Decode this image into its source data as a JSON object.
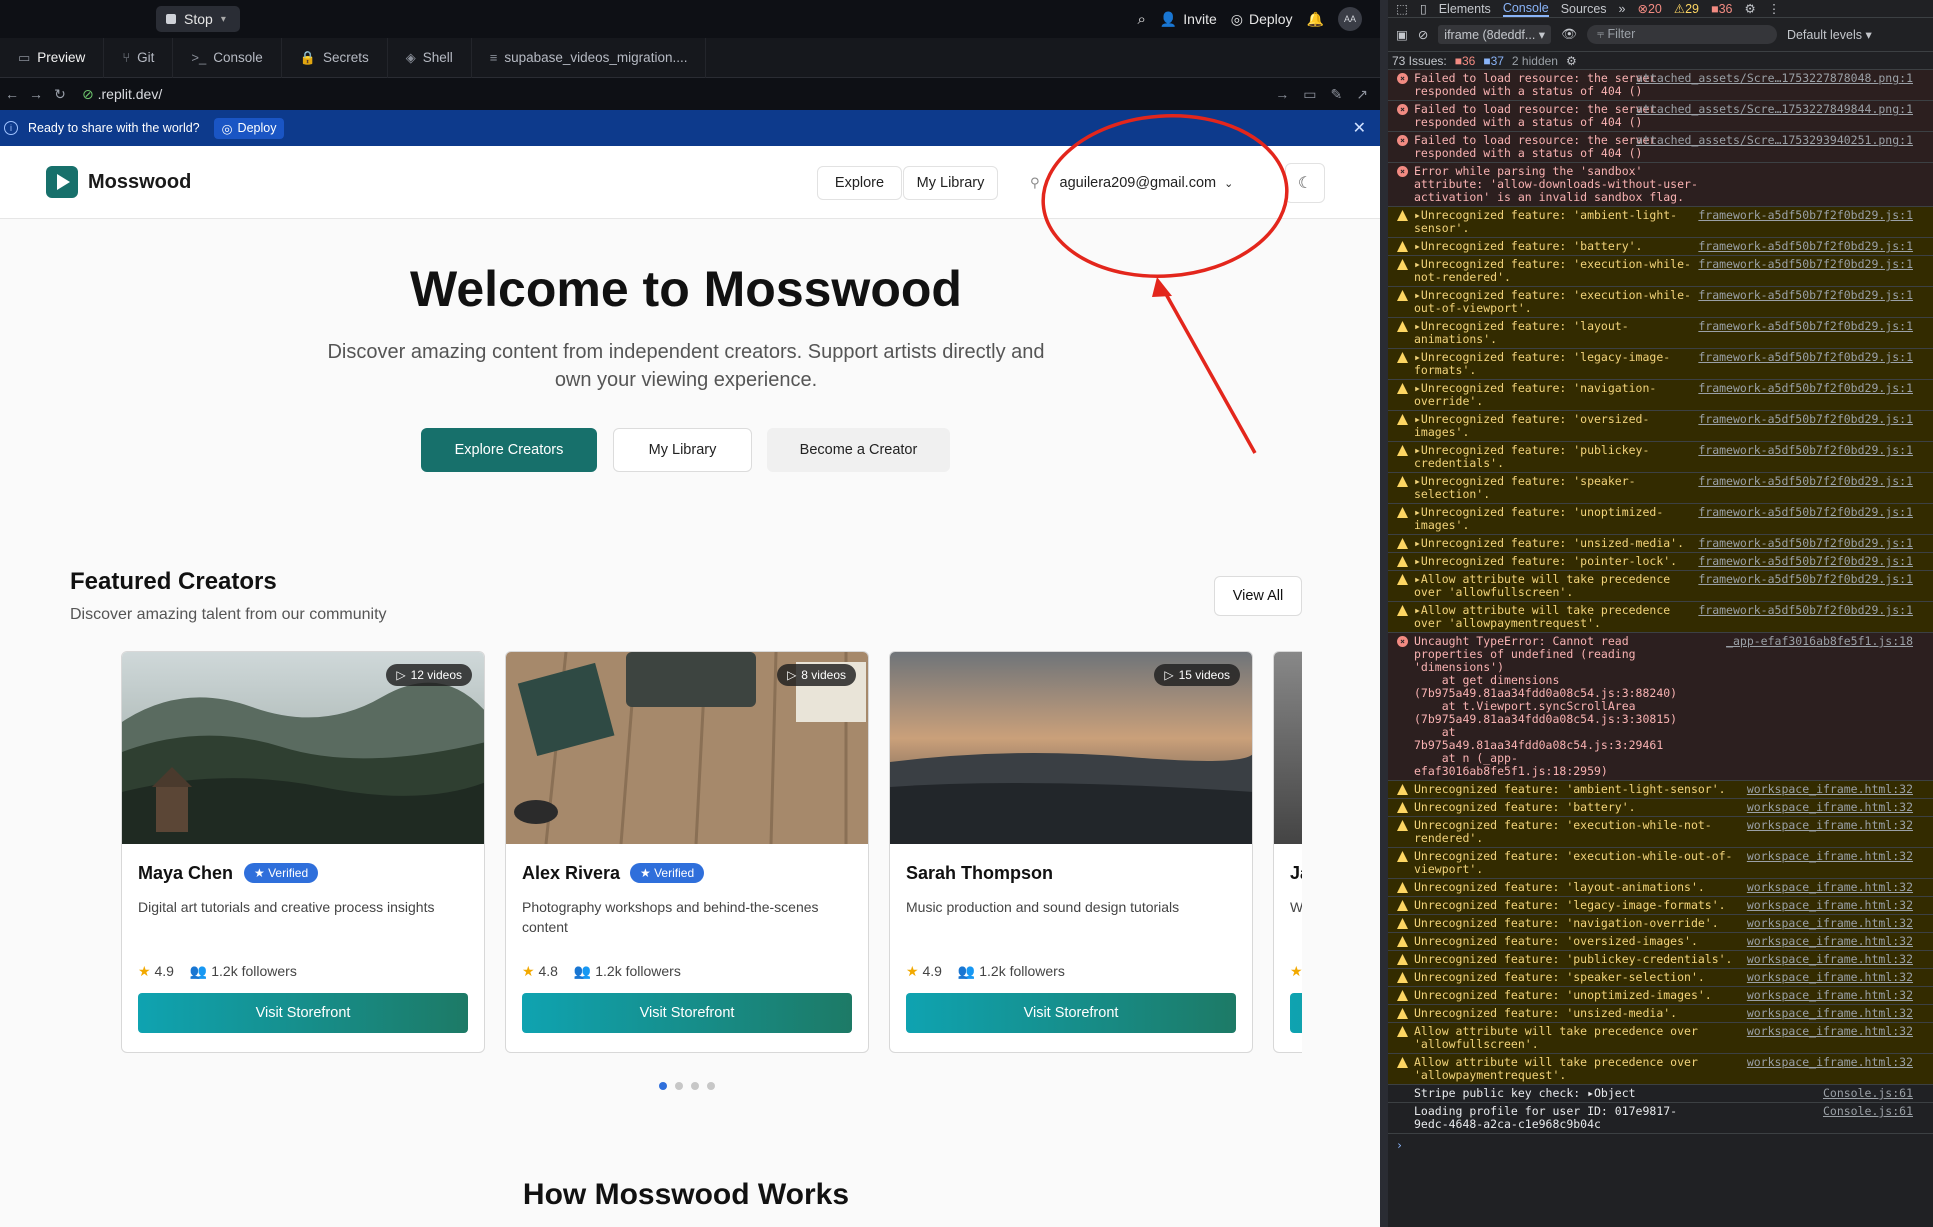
{
  "replit": {
    "stop_label": "Stop",
    "invite_label": "Invite",
    "deploy_label": "Deploy",
    "avatar_initials": "AA",
    "tabs": [
      {
        "label": "Preview",
        "icon": "monitor-icon"
      },
      {
        "label": "Git",
        "icon": "git-icon"
      },
      {
        "label": "Console",
        "icon": "terminal-icon"
      },
      {
        "label": "Secrets",
        "icon": "lock-icon"
      },
      {
        "label": "Shell",
        "icon": "shell-icon"
      },
      {
        "label": "supabase_videos_migration....",
        "icon": "file-icon"
      }
    ],
    "url": ".replit.dev/",
    "banner_text": "Ready to share with the world?",
    "banner_deploy": "Deploy"
  },
  "site": {
    "brand": "Mosswood",
    "nav": {
      "explore": "Explore",
      "library": "My Library"
    },
    "user_email": "aguilera209@gmail.com",
    "hero": {
      "title": "Welcome to Mosswood",
      "subtitle": "Discover amazing content from independent creators. Support artists directly and own your viewing experience.",
      "primary": "Explore Creators",
      "secondary": "My Library",
      "tertiary": "Become a Creator"
    },
    "featured": {
      "title": "Featured Creators",
      "subtitle": "Discover amazing talent from our community",
      "view_all": "View All"
    },
    "cards": [
      {
        "badge": "12 videos",
        "name": "Maya Chen",
        "verified": "Verified",
        "desc": "Digital art tutorials and creative process insights",
        "rating": "4.9",
        "followers": "1.2k followers",
        "cta": "Visit Storefront"
      },
      {
        "badge": "8 videos",
        "name": "Alex Rivera",
        "verified": "Verified",
        "desc": "Photography workshops and behind-the-scenes content",
        "rating": "4.8",
        "followers": "1.2k followers",
        "cta": "Visit Storefront"
      },
      {
        "badge": "15 videos",
        "name": "Sarah Thompson",
        "verified": "",
        "desc": "Music production and sound design tutorials",
        "rating": "4.9",
        "followers": "1.2k followers",
        "cta": "Visit Storefront"
      },
      {
        "badge": "",
        "name": "Ja",
        "verified": "",
        "desc": "W",
        "rating": "",
        "followers": "",
        "cta": ""
      }
    ],
    "how_title": "How Mosswood Works"
  },
  "devtools": {
    "tabs": [
      "Elements",
      "Console",
      "Sources"
    ],
    "err_count": "20",
    "warn_count": "29",
    "issue_count": "36",
    "context": "iframe (8deddf...",
    "filter": "Filter",
    "levels": "Default levels",
    "issues_label": "73 Issues:",
    "issues_err": "36",
    "issues_info": "37",
    "hidden": "2 hidden",
    "logs": [
      {
        "level": "err",
        "msg": "Failed to load resource: the server responded with a status of 404 ()",
        "src": "attached_assets/Scre…1753227878048.png:1"
      },
      {
        "level": "err",
        "msg": "Failed to load resource: the server responded with a status of 404 ()",
        "src": "attached_assets/Scre…1753227849844.png:1"
      },
      {
        "level": "err",
        "msg": "Failed to load resource: the server responded with a status of 404 ()",
        "src": "attached_assets/Scre…1753293940251.png:1"
      },
      {
        "level": "err",
        "msg": "Error while parsing the 'sandbox' attribute: 'allow-downloads-without-user-activation' is an invalid sandbox flag.",
        "src": ""
      },
      {
        "level": "warn",
        "msg": "▸Unrecognized feature: 'ambient-light-sensor'.",
        "src": "framework-a5df50b7f2f0bd29.js:1"
      },
      {
        "level": "warn",
        "msg": "▸Unrecognized feature: 'battery'.",
        "src": "framework-a5df50b7f2f0bd29.js:1"
      },
      {
        "level": "warn",
        "msg": "▸Unrecognized feature: 'execution-while-not-rendered'.",
        "src": "framework-a5df50b7f2f0bd29.js:1"
      },
      {
        "level": "warn",
        "msg": "▸Unrecognized feature: 'execution-while-out-of-viewport'.",
        "src": "framework-a5df50b7f2f0bd29.js:1"
      },
      {
        "level": "warn",
        "msg": "▸Unrecognized feature: 'layout-animations'.",
        "src": "framework-a5df50b7f2f0bd29.js:1"
      },
      {
        "level": "warn",
        "msg": "▸Unrecognized feature: 'legacy-image-formats'.",
        "src": "framework-a5df50b7f2f0bd29.js:1"
      },
      {
        "level": "warn",
        "msg": "▸Unrecognized feature: 'navigation-override'.",
        "src": "framework-a5df50b7f2f0bd29.js:1"
      },
      {
        "level": "warn",
        "msg": "▸Unrecognized feature: 'oversized-images'.",
        "src": "framework-a5df50b7f2f0bd29.js:1"
      },
      {
        "level": "warn",
        "msg": "▸Unrecognized feature: 'publickey-credentials'.",
        "src": "framework-a5df50b7f2f0bd29.js:1"
      },
      {
        "level": "warn",
        "msg": "▸Unrecognized feature: 'speaker-selection'.",
        "src": "framework-a5df50b7f2f0bd29.js:1"
      },
      {
        "level": "warn",
        "msg": "▸Unrecognized feature: 'unoptimized-images'.",
        "src": "framework-a5df50b7f2f0bd29.js:1"
      },
      {
        "level": "warn",
        "msg": "▸Unrecognized feature: 'unsized-media'.",
        "src": "framework-a5df50b7f2f0bd29.js:1"
      },
      {
        "level": "warn",
        "msg": "▸Unrecognized feature: 'pointer-lock'.",
        "src": "framework-a5df50b7f2f0bd29.js:1"
      },
      {
        "level": "warn",
        "msg": "▸Allow attribute will take precedence over 'allowfullscreen'.",
        "src": "framework-a5df50b7f2f0bd29.js:1"
      },
      {
        "level": "warn",
        "msg": "▸Allow attribute will take precedence over 'allowpaymentrequest'.",
        "src": "framework-a5df50b7f2f0bd29.js:1"
      },
      {
        "level": "err",
        "msg": "Uncaught TypeError: Cannot read properties of undefined (reading 'dimensions')\n    at get dimensions (7b975a49.81aa34fdd0a08c54.js:3:88240)\n    at t.Viewport.syncScrollArea (7b975a49.81aa34fdd0a08c54.js:3:30815)\n    at 7b975a49.81aa34fdd0a08c54.js:3:29461\n    at n (_app-efaf3016ab8fe5f1.js:18:2959)",
        "src": "_app-efaf3016ab8fe5f1.js:18"
      },
      {
        "level": "warn",
        "msg": "Unrecognized feature: 'ambient-light-sensor'.",
        "src": "workspace_iframe.html:32"
      },
      {
        "level": "warn",
        "msg": "Unrecognized feature: 'battery'.",
        "src": "workspace_iframe.html:32"
      },
      {
        "level": "warn",
        "msg": "Unrecognized feature: 'execution-while-not-rendered'.",
        "src": "workspace_iframe.html:32"
      },
      {
        "level": "warn",
        "msg": "Unrecognized feature: 'execution-while-out-of-viewport'.",
        "src": "workspace_iframe.html:32"
      },
      {
        "level": "warn",
        "msg": "Unrecognized feature: 'layout-animations'.",
        "src": "workspace_iframe.html:32"
      },
      {
        "level": "warn",
        "msg": "Unrecognized feature: 'legacy-image-formats'.",
        "src": "workspace_iframe.html:32"
      },
      {
        "level": "warn",
        "msg": "Unrecognized feature: 'navigation-override'.",
        "src": "workspace_iframe.html:32"
      },
      {
        "level": "warn",
        "msg": "Unrecognized feature: 'oversized-images'.",
        "src": "workspace_iframe.html:32"
      },
      {
        "level": "warn",
        "msg": "Unrecognized feature: 'publickey-credentials'.",
        "src": "workspace_iframe.html:32"
      },
      {
        "level": "warn",
        "msg": "Unrecognized feature: 'speaker-selection'.",
        "src": "workspace_iframe.html:32"
      },
      {
        "level": "warn",
        "msg": "Unrecognized feature: 'unoptimized-images'.",
        "src": "workspace_iframe.html:32"
      },
      {
        "level": "warn",
        "msg": "Unrecognized feature: 'unsized-media'.",
        "src": "workspace_iframe.html:32"
      },
      {
        "level": "warn",
        "msg": "Allow attribute will take precedence over 'allowfullscreen'.",
        "src": "workspace_iframe.html:32"
      },
      {
        "level": "warn",
        "msg": "Allow attribute will take precedence over 'allowpaymentrequest'.",
        "src": "workspace_iframe.html:32"
      },
      {
        "level": "info",
        "msg": "Stripe public key check: ▸Object",
        "src": "Console.js:61"
      },
      {
        "level": "info",
        "msg": "Loading profile for user ID: 017e9817-9edc-4648-a2ca-c1e968c9b04c",
        "src": "Console.js:61"
      }
    ]
  },
  "annotation": {
    "color": "#e3261c"
  }
}
